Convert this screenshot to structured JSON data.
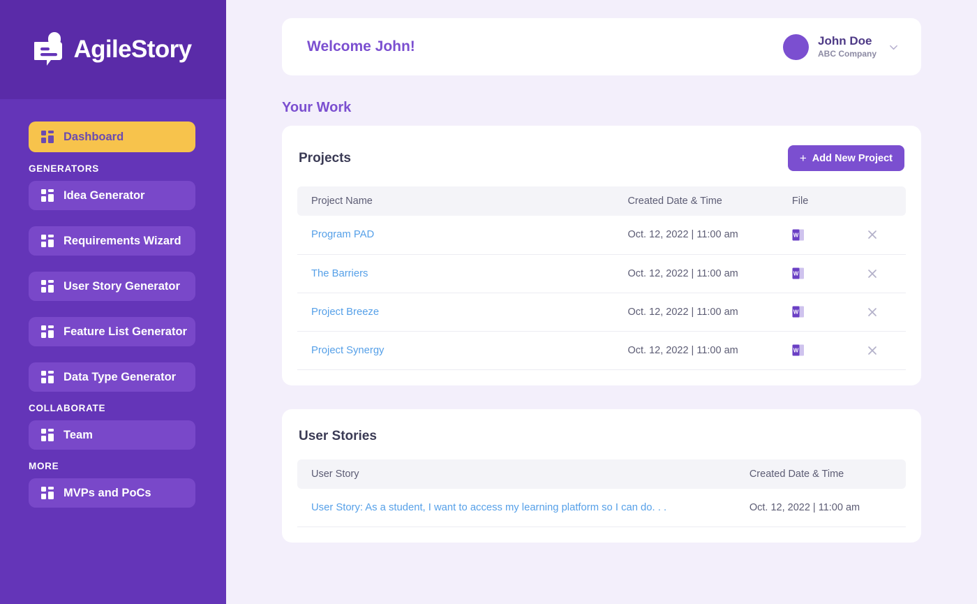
{
  "brand": {
    "name": "AgileStory",
    "logo_icon": "agilestory-logo-icon",
    "sidebar_top_color": "#5A2BA8",
    "sidebar_color": "#6435B8",
    "accent_color": "#7B4FD0",
    "active_color": "#F7C34C",
    "page_bg": "#F3EFFB"
  },
  "sidebar": {
    "primary": [
      {
        "label": "Dashboard",
        "icon": "grid-icon",
        "active": true
      }
    ],
    "sections": [
      {
        "label": "GENERATORS",
        "items": [
          {
            "label": "Idea Generator",
            "icon": "grid-icon"
          },
          {
            "label": "Requirements Wizard",
            "icon": "grid-icon"
          },
          {
            "label": "User Story Generator",
            "icon": "grid-icon"
          },
          {
            "label": "Feature List Generator",
            "icon": "grid-icon"
          },
          {
            "label": "Data Type Generator",
            "icon": "grid-icon"
          }
        ]
      },
      {
        "label": "COLLABORATE",
        "items": [
          {
            "label": "Team",
            "icon": "grid-icon"
          }
        ]
      },
      {
        "label": "MORE",
        "items": [
          {
            "label": "MVPs and PoCs",
            "icon": "grid-icon"
          }
        ]
      }
    ]
  },
  "topbar": {
    "welcome": "Welcome John!",
    "user": {
      "name": "John Doe",
      "company": "ABC Company",
      "avatar_icon": "avatar",
      "chevron_icon": "chevron-down-icon"
    }
  },
  "page": {
    "section_title": "Your Work"
  },
  "projects": {
    "title": "Projects",
    "add_button": "Add New Project",
    "add_icon": "plus-icon",
    "columns": [
      "Project Name",
      "Created Date & Time",
      "File",
      ""
    ],
    "rows": [
      {
        "name": "Program PAD",
        "date": "Oct. 12, 2022  |  11:00 am",
        "file_icon": "word-file-icon",
        "delete_icon": "close-icon"
      },
      {
        "name": "The Barriers",
        "date": "Oct. 12, 2022  |  11:00 am",
        "file_icon": "word-file-icon",
        "delete_icon": "close-icon"
      },
      {
        "name": "Project Breeze",
        "date": "Oct. 12, 2022  |  11:00 am",
        "file_icon": "word-file-icon",
        "delete_icon": "close-icon"
      },
      {
        "name": "Project Synergy",
        "date": "Oct. 12, 2022  |  11:00 am",
        "file_icon": "word-file-icon",
        "delete_icon": "close-icon"
      }
    ]
  },
  "user_stories": {
    "title": "User Stories",
    "columns": [
      "User Story",
      "Created Date & Time"
    ],
    "rows": [
      {
        "story": "User Story: As a student, I want to access my learning platform so I can do. . .",
        "date": "Oct. 12, 2022  |  11:00 am"
      }
    ]
  }
}
